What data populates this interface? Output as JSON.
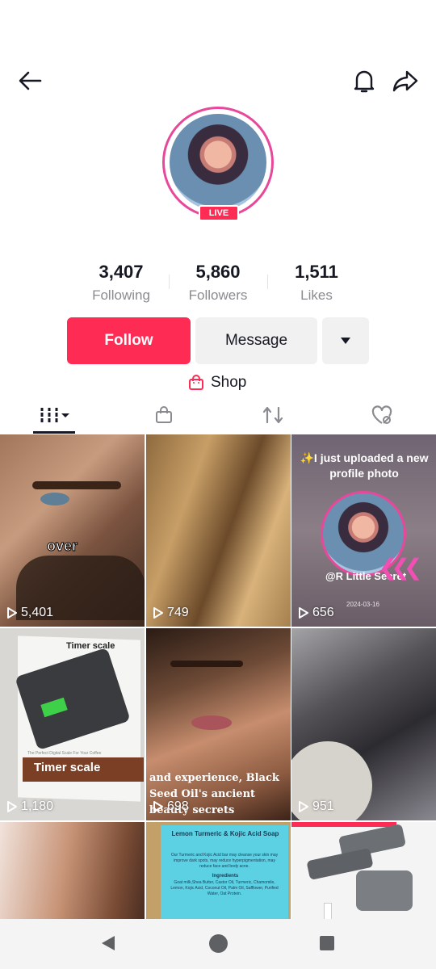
{
  "header": {
    "back_icon": "back-arrow-icon",
    "bell_icon": "bell-icon",
    "share_icon": "share-icon"
  },
  "profile": {
    "live_label": "LIVE"
  },
  "stats": [
    {
      "value": "3,407",
      "label": "Following"
    },
    {
      "value": "5,860",
      "label": "Followers"
    },
    {
      "value": "1,511",
      "label": "Likes"
    }
  ],
  "actions": {
    "follow_label": "Follow",
    "message_label": "Message"
  },
  "shop": {
    "label": "Shop"
  },
  "tabs": [
    "videos-grid-icon",
    "shop-bag-icon",
    "repost-icon",
    "liked-hidden-icon"
  ],
  "videos": [
    {
      "views": "5,401",
      "caption": "over"
    },
    {
      "views": "749"
    },
    {
      "views": "656",
      "caption": "✨I just uploaded a new profile photo",
      "handle": "@R Little Secret",
      "date": "2024-03-16"
    },
    {
      "views": "1,180",
      "title": "Timer scale",
      "subtitle": "Timer scale",
      "tagline": "The Perfect Digital Scale For Your Coffee"
    },
    {
      "views": "698",
      "caption": "and experience, Black Seed Oil's ancient beauty secrets"
    },
    {
      "views": "951"
    },
    {
      "views": ""
    },
    {
      "views": "",
      "title": "Lemon Turmeric & Kojic Acid Soap",
      "body": "Our Turmeric and Kojic Acid bar may cleanse your skin may improve dark spots, may reduce hyperpigmentation, may reduce face and body acne.",
      "ing_title": "Ingredients",
      "ingredients": "Goat milk,Shea Butter, Castor Oil, Turmeric, Chamomile, Lemon, Kojic Acid, Coconut Oil, Palm Oil, Safflower, Purified Water, Oat Protein."
    },
    {
      "views": ""
    }
  ]
}
